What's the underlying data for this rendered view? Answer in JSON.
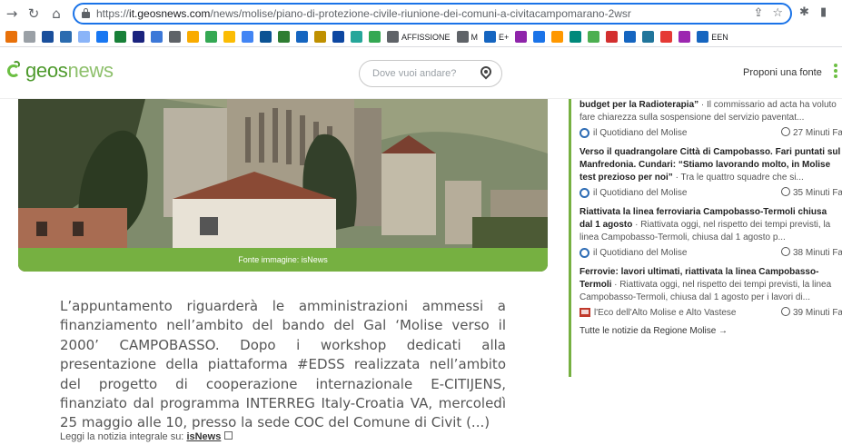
{
  "browser": {
    "url_prefix": "https://",
    "url_host": "it.geosnews.com",
    "url_path": "/news/molise/piano-di-protezione-civile-riunione-dei-comuni-a-civitacampomarano-2wsr",
    "bookmarks": [
      {
        "label": "",
        "color": "#e8710a"
      },
      {
        "label": "",
        "color": "#9aa0a6"
      },
      {
        "label": "",
        "color": "#1a4f9c"
      },
      {
        "label": "",
        "color": "#2b6cb0"
      },
      {
        "label": "",
        "color": "#8ab4f8"
      },
      {
        "label": "",
        "color": "#1877f2"
      },
      {
        "label": "",
        "color": "#188038"
      },
      {
        "label": "",
        "color": "#1a237e"
      },
      {
        "label": "",
        "color": "#3c78d8"
      },
      {
        "label": "",
        "color": "#5f6368"
      },
      {
        "label": "",
        "color": "#f9ab00"
      },
      {
        "label": "",
        "color": "#34a853"
      },
      {
        "label": "",
        "color": "#fbbc04"
      },
      {
        "label": "",
        "color": "#4285f4"
      },
      {
        "label": "",
        "color": "#0b5394"
      },
      {
        "label": "",
        "color": "#2e7d32"
      },
      {
        "label": "",
        "color": "#1565c0"
      },
      {
        "label": "",
        "color": "#bf9000"
      },
      {
        "label": "",
        "color": "#0d47a1"
      },
      {
        "label": "",
        "color": "#26a69a"
      },
      {
        "label": "",
        "color": "#34a853"
      },
      {
        "label": "AFFISSIONE",
        "color": "#5f6368"
      },
      {
        "label": "M",
        "color": "#5f6368"
      },
      {
        "label": "E+",
        "color": "#1565c0"
      },
      {
        "label": "",
        "color": "#8e24aa"
      },
      {
        "label": "",
        "color": "#1a73e8"
      },
      {
        "label": "",
        "color": "#ff9800"
      },
      {
        "label": "",
        "color": "#00897b"
      },
      {
        "label": "",
        "color": "#4caf50"
      },
      {
        "label": "",
        "color": "#d32f2f"
      },
      {
        "label": "",
        "color": "#1565c0"
      },
      {
        "label": "",
        "color": "#21759b"
      },
      {
        "label": "",
        "color": "#e53935"
      },
      {
        "label": "",
        "color": "#9c27b0"
      },
      {
        "label": "EEN",
        "color": "#1565c0"
      }
    ]
  },
  "header": {
    "logo_main": "geos",
    "logo_light": "news",
    "search_placeholder": "Dove vuoi andare?",
    "propose_label": "Proponi una fonte"
  },
  "hero": {
    "caption": "Fonte immagine: isNews"
  },
  "article": {
    "body": "L’appuntamento riguarderà le amministrazioni ammessi a finanziamento nell’ambito del bando del Gal ‘Molise verso il 2000’ CAMPOBASSO. Dopo i workshop dedicati alla presentazione della piattaforma #EDSS realizzata nell’ambito del progetto di cooperazione internazionale E-CITIJENS, finanziato dal programma INTERREG Italy-Croatia VA, mercoledì 25 maggio alle 10, presso la sede COC del Comune di Civit (...)",
    "read_more_prefix": "Leggi la notizia integrale su: ",
    "read_more_source": "isNews"
  },
  "sidebar": {
    "items": [
      {
        "title": "budget per la Radioterapia”",
        "summary": " · Il commissario ad acta ha voluto fare chiarezza sulla sospensione del servizio paventat...",
        "source": "il Quotidiano del Molise",
        "time": "27 Minuti Fa"
      },
      {
        "title": "Verso il quadrangolare Città di Campobasso. Fari puntati sul Manfredonia. Cundari: “Stiamo lavorando molto, in Molise test prezioso per noi”",
        "summary": " · Tra le quattro squadre che si...",
        "source": "il Quotidiano del Molise",
        "time": "35 Minuti Fa"
      },
      {
        "title": "Riattivata la linea ferroviaria Campobasso-Termoli chiusa dal 1 agosto",
        "summary": " · Riattivata oggi,  nel rispetto dei tempi previsti, la linea Campobasso-Termoli, chiusa dal 1 agosto p...",
        "source": "il Quotidiano del Molise",
        "time": "38 Minuti Fa"
      },
      {
        "title": "Ferrovie: lavori ultimati, riattivata la linea Campobasso-Termoli",
        "summary": " · Riattivata oggi,  nel rispetto dei tempi previsti, la linea Campobasso-Termoli, chiusa dal 1 agosto per i lavori di...",
        "source": "l'Eco dell'Alto Molise e Alto Vastese",
        "time": "39 Minuti Fa"
      }
    ],
    "all_news": "Tutte le notizie da Regione Molise →"
  }
}
